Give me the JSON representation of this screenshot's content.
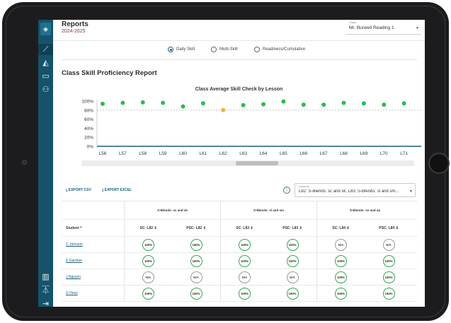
{
  "app": {
    "title": "Reports",
    "subtitle": "2024-2025",
    "class_label": "Class",
    "class_value": "Mr. Burwell Reading 1"
  },
  "sidebar": {
    "icons": [
      "logo-icon",
      "chart-line-icon",
      "graduation-cap-icon",
      "folder-icon",
      "users-icon",
      "library-icon",
      "flask-icon",
      "logout-icon"
    ]
  },
  "report_types": {
    "options": [
      "Daily Skill",
      "Multi-Skill",
      "Readiness/Cumulative"
    ],
    "selected": "Daily Skill"
  },
  "report": {
    "title": "Class Skill Proficiency Report"
  },
  "chart_data": {
    "type": "scatter",
    "title": "Class Average Skill Check by Lesson",
    "categories": [
      "L56",
      "L57",
      "L58",
      "L59",
      "L60",
      "L61",
      "L62",
      "L63",
      "L64",
      "L65",
      "L66",
      "L67",
      "L68",
      "L69",
      "L70",
      "L71"
    ],
    "values": [
      94,
      96,
      97,
      96,
      88,
      95,
      80,
      91,
      93,
      99,
      92,
      92,
      96,
      95,
      92,
      95
    ],
    "point_colors": [
      "#2bbd4a",
      "#2bbd4a",
      "#2bbd4a",
      "#2bbd4a",
      "#2bbd4a",
      "#2bbd4a",
      "#f5b13b",
      "#2bbd4a",
      "#2bbd4a",
      "#2bbd4a",
      "#2bbd4a",
      "#2bbd4a",
      "#2bbd4a",
      "#2bbd4a",
      "#2bbd4a",
      "#2bbd4a"
    ],
    "yticks": [
      "100%",
      "80%",
      "60%",
      "40%",
      "20%",
      "0%"
    ],
    "ylim": [
      0,
      100
    ],
    "reference_line": 80
  },
  "toolbar": {
    "export_csv": "EXPORT CSV",
    "export_excel": "EXPORT EXCEL",
    "lessons_label": "Lessons",
    "lessons_value": "L82: S-Blends: sc and sk, L83: S-Blends: sl and sm..."
  },
  "table": {
    "groups": [
      "S-Blends: sc and sk",
      "S-Blends: sl and sm",
      "S-Blends: sn and sp"
    ],
    "student_header": "Student ^",
    "columns": [
      "SC: L82 ⇕",
      "PSC: L82 ⇕",
      "SC: L83 ⇕",
      "PSC: L83 ⇕",
      "SC: L84 ⇕",
      "PSC: L84 ⇕"
    ],
    "rows": [
      {
        "student": "C Johnson",
        "cells": [
          "100%",
          "100%",
          "100%",
          "100%",
          "N/A",
          "N/A"
        ]
      },
      {
        "student": "E Gardner",
        "cells": [
          "100%",
          "100%",
          "100%",
          "100%",
          "100%",
          "100%"
        ]
      },
      {
        "student": "J Nguyen",
        "cells": [
          "N/A",
          "N/A",
          "N/A",
          "N/A",
          "100%",
          "100%"
        ]
      },
      {
        "student": "G Hess",
        "cells": [
          "100%",
          "100%",
          "100%",
          "100%",
          "100%",
          "100%"
        ]
      }
    ]
  },
  "colors": {
    "sidebar": "#16536b",
    "accent": "#1b5f78",
    "proficient": "#2bbd4a",
    "warning": "#f5b13b"
  }
}
